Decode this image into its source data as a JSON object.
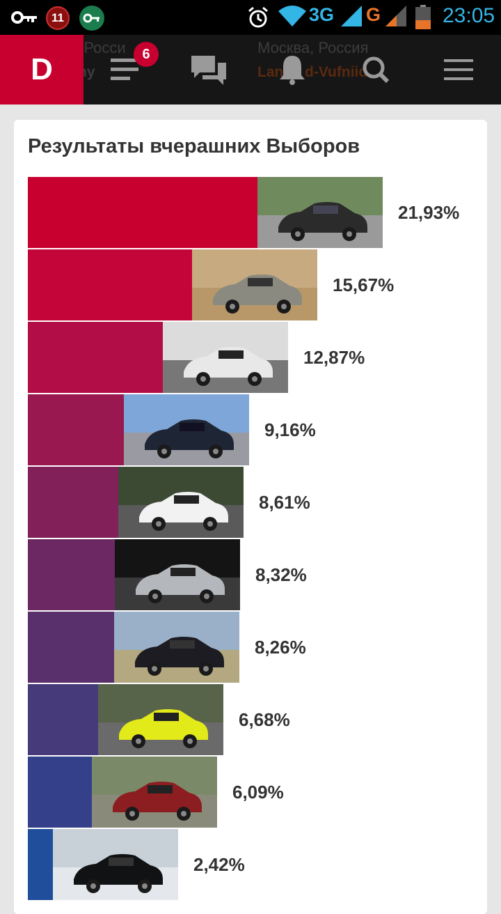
{
  "status_bar": {
    "notification_count": "11",
    "network_type_1": "3G",
    "network_type_2": "G",
    "time": "23:05",
    "icons": [
      "key-icon",
      "notification-count-badge",
      "vpn-key-icon",
      "alarm-icon",
      "wifi-icon",
      "signal-icon",
      "battery-icon"
    ]
  },
  "nav": {
    "logo": "D",
    "feed_badge": "6",
    "background_text": {
      "city_left": "a, Росси",
      "user_left": "ny",
      "city_right": "Москва, Россия",
      "user_right": "Lan",
      "user_right_tail": "d-Vufniid"
    },
    "icons": [
      "feed-icon",
      "chat-icon",
      "bell-icon",
      "search-icon",
      "menu-icon"
    ]
  },
  "card": {
    "title": "Результаты вчерашних Выборов",
    "results": [
      {
        "percent_label": "21,93%",
        "value": 21.93,
        "color": "#c8002f",
        "photo": "black-coupe-photo"
      },
      {
        "percent_label": "15,67%",
        "value": 15.67,
        "color": "#c4053a",
        "photo": "offroad-suv-photo"
      },
      {
        "percent_label": "12,87%",
        "value": 12.87,
        "color": "#b30d48",
        "photo": "promo-girls-car-photo"
      },
      {
        "percent_label": "9,16%",
        "value": 9.16,
        "color": "#9a1850",
        "photo": "hatchback-circle-photo"
      },
      {
        "percent_label": "8,61%",
        "value": 8.61,
        "color": "#82205a",
        "photo": "white-sedan-photo"
      },
      {
        "percent_label": "8,32%",
        "value": 8.32,
        "color": "#6c2862",
        "photo": "silver-sedan-night-photo"
      },
      {
        "percent_label": "8,26%",
        "value": 8.26,
        "color": "#5a306c",
        "photo": "dark-sedan-field-photo"
      },
      {
        "percent_label": "6,68%",
        "value": 6.68,
        "color": "#463a7a",
        "photo": "yellow-cars-photo"
      },
      {
        "percent_label": "6,09%",
        "value": 6.09,
        "color": "#34408a",
        "photo": "red-pt-cruiser-photo"
      },
      {
        "percent_label": "2,42%",
        "value": 2.42,
        "color": "#214e9a",
        "photo": "black-sedan-snow-photo"
      }
    ]
  }
}
